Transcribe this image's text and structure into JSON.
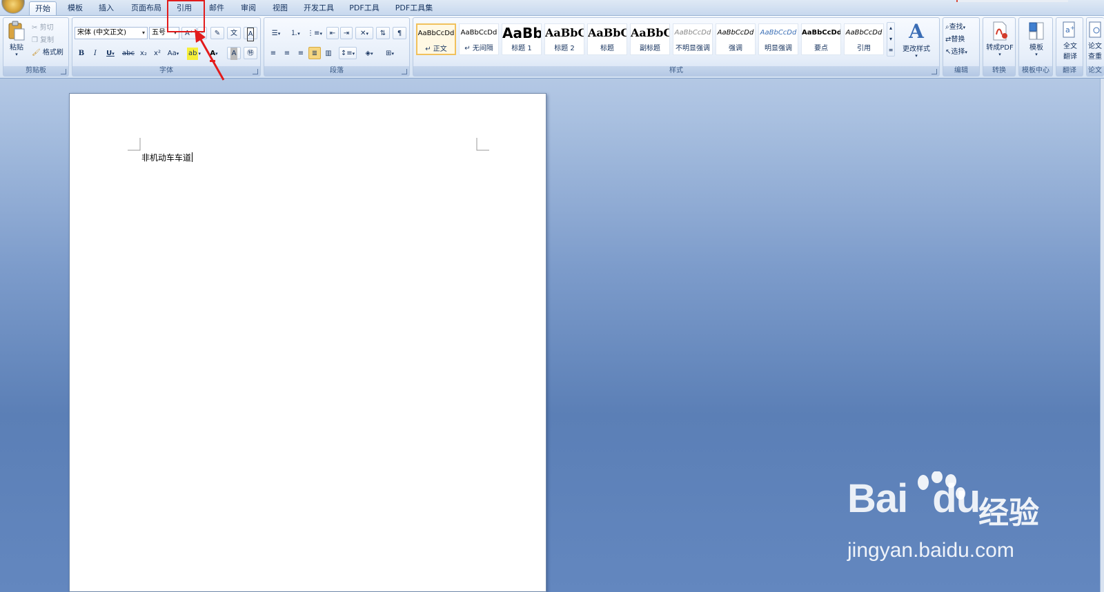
{
  "tabs": [
    {
      "label": "开始",
      "active": true
    },
    {
      "label": "模板"
    },
    {
      "label": "插入"
    },
    {
      "label": "页面布局"
    },
    {
      "label": "引用"
    },
    {
      "label": "邮件"
    },
    {
      "label": "审阅"
    },
    {
      "label": "视图"
    },
    {
      "label": "开发工具"
    },
    {
      "label": "PDF工具"
    },
    {
      "label": "PDF工具集"
    }
  ],
  "clipboard": {
    "paste": "粘贴",
    "cut": "剪切",
    "copy": "复制",
    "format_painter": "格式刷",
    "group_label": "剪贴板"
  },
  "font": {
    "font_name": "宋体 (中文正文)",
    "font_size": "五号",
    "group_label": "字体"
  },
  "paragraph": {
    "group_label": "段落"
  },
  "styles": {
    "group_label": "样式",
    "items": [
      {
        "preview": "AaBbCcDd",
        "name": "正文",
        "selected": true
      },
      {
        "preview": "AaBbCcDd",
        "name": "无间隔"
      },
      {
        "preview": "AaBb",
        "name": "标题 1"
      },
      {
        "preview": "AaBbC",
        "name": "标题 2"
      },
      {
        "preview": "AaBbC",
        "name": "标题"
      },
      {
        "preview": "AaBbC",
        "name": "副标题"
      },
      {
        "preview": "AaBbCcDd",
        "name": "不明显强调"
      },
      {
        "preview": "AaBbCcDd",
        "name": "强调"
      },
      {
        "preview": "AaBbCcDd",
        "name": "明显强调"
      },
      {
        "preview": "AaBbCcDd",
        "name": "要点"
      },
      {
        "preview": "AaBbCcDd",
        "name": "引用"
      }
    ],
    "change_styles": "更改样式"
  },
  "editing": {
    "find": "查找",
    "replace": "替换",
    "select": "选择",
    "group_label": "编辑"
  },
  "convert": {
    "to_pdf": "转成PDF",
    "group_label": "转换"
  },
  "template": {
    "label": "模板",
    "group_label": "模板中心"
  },
  "translate": {
    "label_line1": "全文",
    "label_line2": "翻译",
    "group_label": "翻译"
  },
  "paper": {
    "label_line1": "论文",
    "label_line2": "查重",
    "group_label": "论文"
  },
  "document": {
    "text": "非机动车车道"
  },
  "watermark": {
    "brand": "Bai",
    "brand2": "du",
    "cn": "经验",
    "url": "jingyan.baidu.com"
  },
  "colors": {
    "annotation_red": "#e21b1b",
    "style_selected_border": "#f1c15c"
  }
}
